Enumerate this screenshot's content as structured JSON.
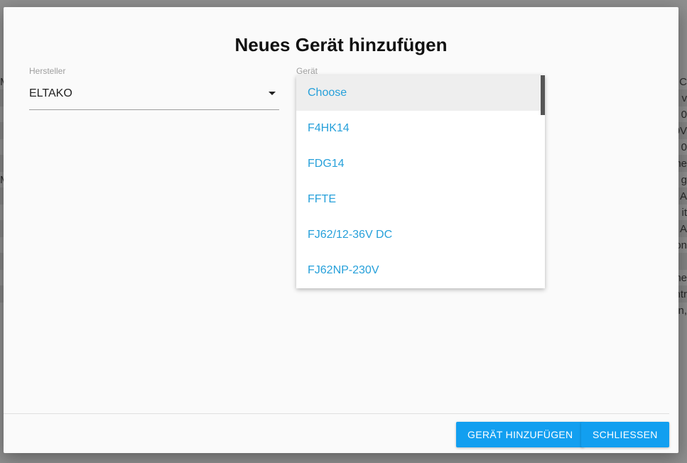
{
  "background": {
    "right_fragments": [
      "C",
      "v",
      "0",
      "0V",
      "0",
      "ne",
      "g",
      "A",
      "it",
      "A",
      "on",
      "ne",
      "ntr",
      "n,"
    ],
    "left_fragments": [
      "M",
      "M"
    ]
  },
  "dialog": {
    "title": "Neues Gerät hinzufügen"
  },
  "manufacturer": {
    "label": "Hersteller",
    "value": "ELTAKO"
  },
  "device": {
    "label": "Gerät",
    "options": [
      {
        "label": "Choose",
        "active": true
      },
      {
        "label": "F4HK14",
        "active": false
      },
      {
        "label": "FDG14",
        "active": false
      },
      {
        "label": "FFTE",
        "active": false
      },
      {
        "label": "FJ62/12-36V DC",
        "active": false
      },
      {
        "label": "FJ62NP-230V",
        "active": false
      }
    ]
  },
  "actions": {
    "add_label": "GERÄT HINZUFÜGEN",
    "close_label": "SCHLIESSEN"
  },
  "colors": {
    "accent": "#129ff0",
    "option_text": "#26a0da"
  }
}
